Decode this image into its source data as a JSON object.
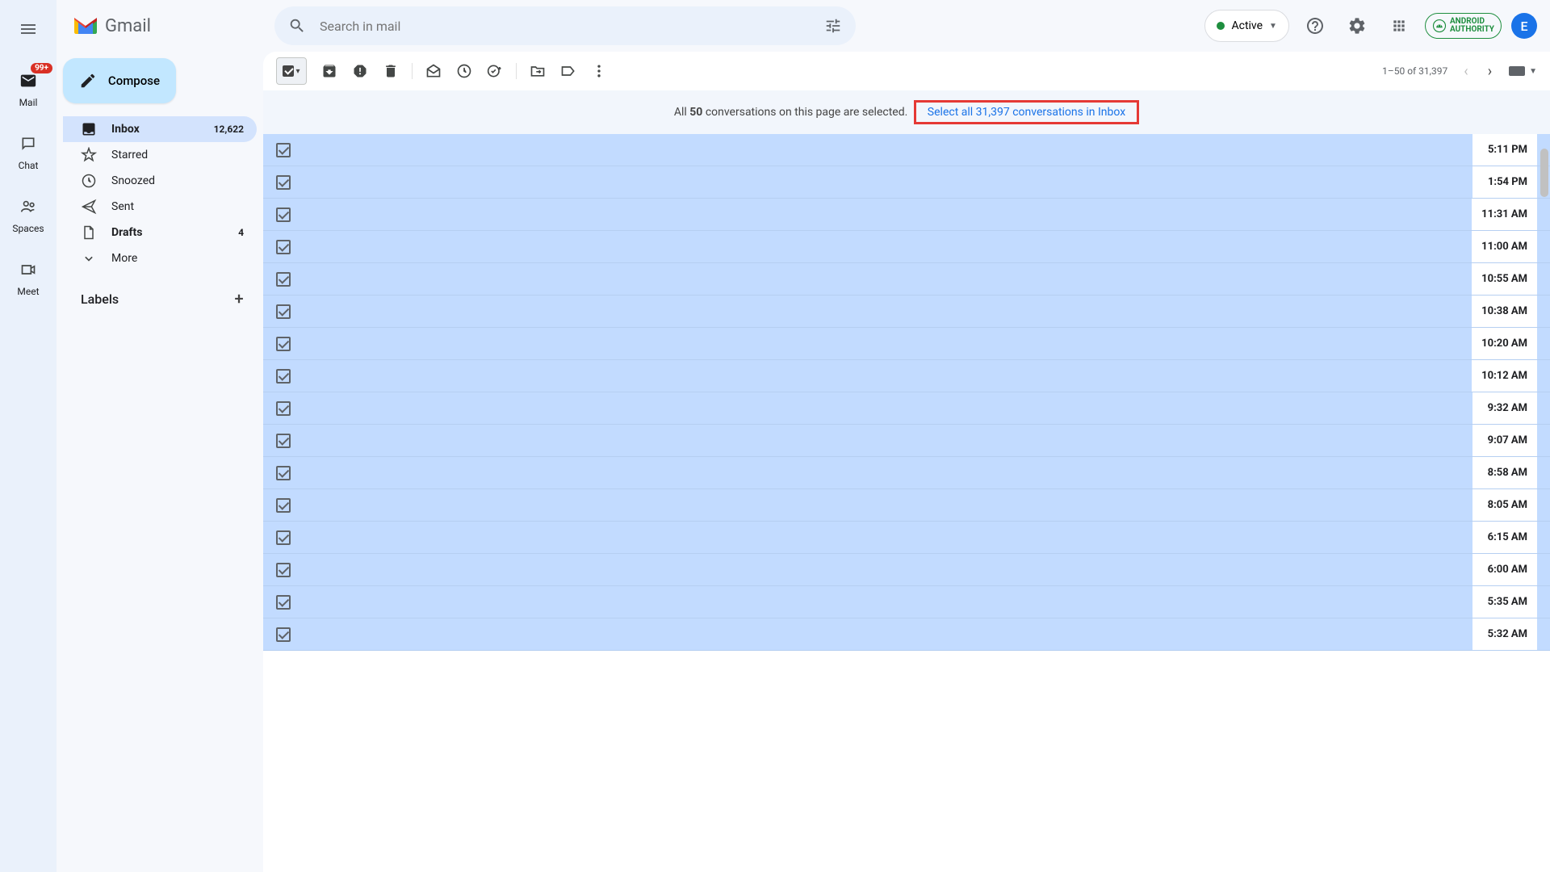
{
  "app": {
    "name": "Gmail"
  },
  "rail": {
    "badge": "99+",
    "items": [
      {
        "label": "Mail"
      },
      {
        "label": "Chat"
      },
      {
        "label": "Spaces"
      },
      {
        "label": "Meet"
      }
    ]
  },
  "search": {
    "placeholder": "Search in mail"
  },
  "status": {
    "label": "Active"
  },
  "brand_badge": {
    "line1": "ANDROID",
    "line2": "AUTHORITY"
  },
  "avatar": {
    "initial": "E"
  },
  "compose": {
    "label": "Compose"
  },
  "sidebar": {
    "items": [
      {
        "label": "Inbox",
        "count": "12,622",
        "active": true,
        "bold": true,
        "icon": "inbox"
      },
      {
        "label": "Starred",
        "icon": "star"
      },
      {
        "label": "Snoozed",
        "icon": "clock"
      },
      {
        "label": "Sent",
        "icon": "send"
      },
      {
        "label": "Drafts",
        "count": "4",
        "bold": true,
        "icon": "file"
      },
      {
        "label": "More",
        "icon": "chevron"
      }
    ],
    "labels_header": "Labels"
  },
  "pagination": {
    "text": "1–50 of 31,397"
  },
  "banner": {
    "prefix": "All ",
    "bold_count": "50",
    "suffix": " conversations on this page are selected.",
    "link": "Select all 31,397 conversations in Inbox"
  },
  "emails": [
    {
      "time": "5:11 PM"
    },
    {
      "time": "1:54 PM"
    },
    {
      "time": "11:31 AM"
    },
    {
      "time": "11:00 AM"
    },
    {
      "time": "10:55 AM"
    },
    {
      "time": "10:38 AM"
    },
    {
      "time": "10:20 AM"
    },
    {
      "time": "10:12 AM"
    },
    {
      "time": "9:32 AM"
    },
    {
      "time": "9:07 AM"
    },
    {
      "time": "8:58 AM"
    },
    {
      "time": "8:05 AM"
    },
    {
      "time": "6:15 AM"
    },
    {
      "time": "6:00 AM"
    },
    {
      "time": "5:35 AM"
    },
    {
      "time": "5:32 AM"
    }
  ]
}
